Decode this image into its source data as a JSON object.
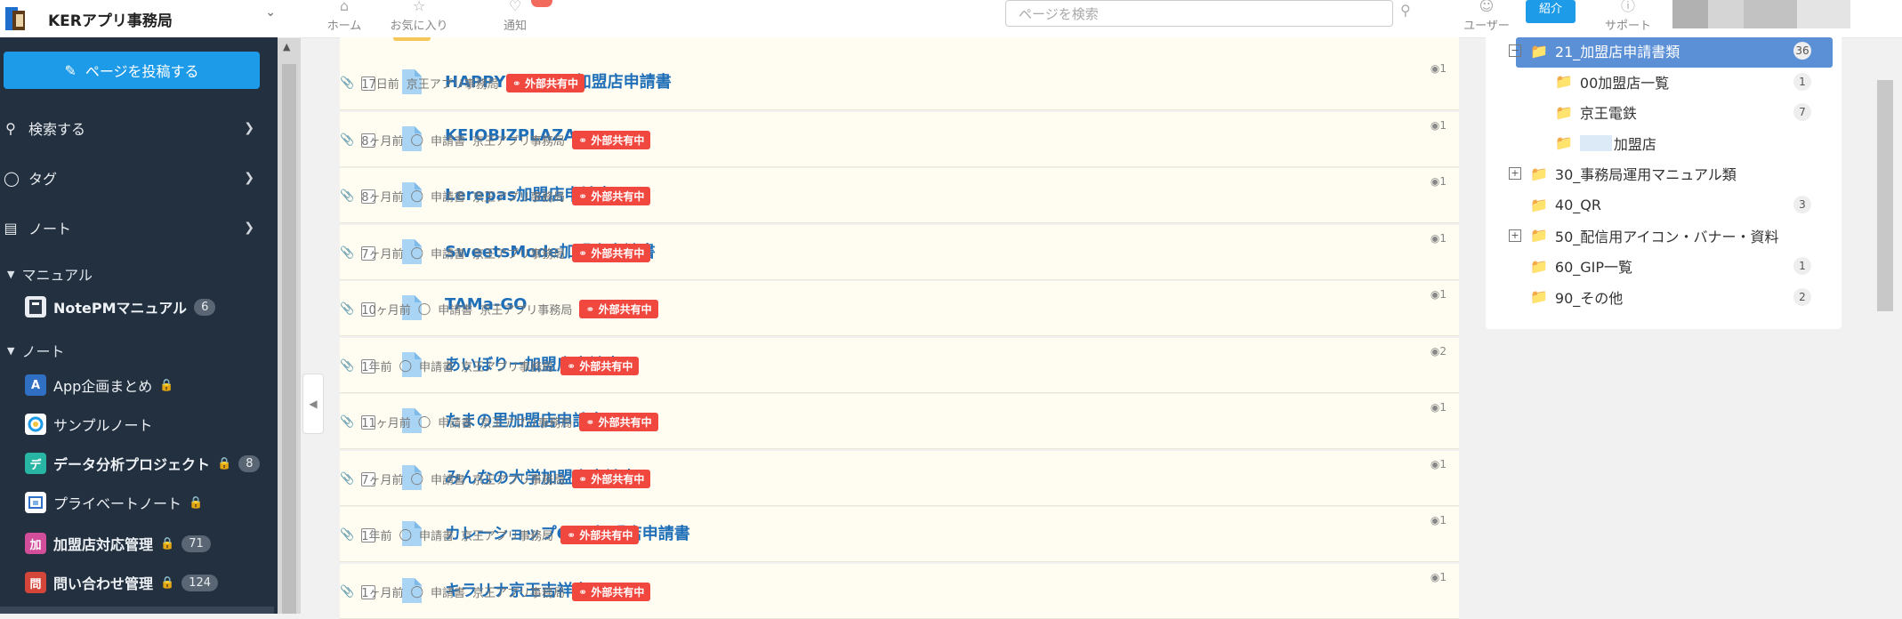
{
  "workspace": {
    "name": "KERアプリ事務局"
  },
  "sidebar": {
    "post_button": "ページを投稿する",
    "menu": [
      {
        "label": "検索する",
        "icon": "search-icon"
      },
      {
        "label": "タグ",
        "icon": "tag-icon"
      },
      {
        "label": "ノート",
        "icon": "notebook-icon"
      }
    ],
    "sections": {
      "manual": "マニュアル",
      "notes": "ノート"
    },
    "manual_items": [
      {
        "label": "NotePMマニュアル",
        "count": "6",
        "icon_color": "#ffffff"
      }
    ],
    "notes": [
      {
        "label": "App企画まとめ",
        "initial": "A",
        "color": "#2f6fc4",
        "locked": true,
        "count": ""
      },
      {
        "label": "サンプルノート",
        "initial": "",
        "color": "#ffffff",
        "locked": false,
        "count": ""
      },
      {
        "label": "データ分析プロジェクト",
        "initial": "デ",
        "color": "#29b5a3",
        "locked": true,
        "count": "8"
      },
      {
        "label": "プライベートノート",
        "initial": "",
        "color": "#ffffff",
        "locked": true,
        "count": ""
      },
      {
        "label": "加盟店対応管理",
        "initial": "加",
        "color": "#d24e9a",
        "locked": true,
        "count": "71"
      },
      {
        "label": "問い合わせ管理",
        "initial": "問",
        "color": "#d5463a",
        "locked": true,
        "count": "124"
      }
    ]
  },
  "topbar": {
    "nav": [
      {
        "label": "ホーム",
        "icon": "home-icon"
      },
      {
        "label": "お気に入り",
        "icon": "star-icon"
      },
      {
        "label": "通知",
        "icon": "bell-icon"
      }
    ],
    "search_placeholder": "ページを検索",
    "user_label": "ユーザー",
    "invite_label": "紹介",
    "support_label": "サポート"
  },
  "pages": [
    {
      "title": "HAPPYLEMON 加盟店申請書",
      "time": "17日前",
      "tag": "",
      "owner": "京王アプリ事務局",
      "share": "外部共有中",
      "views": "1"
    },
    {
      "title": "KEIOBIZPLAZA",
      "time": "8ヶ月前",
      "tag": "申請書",
      "owner": "京王アプリ事務局",
      "share": "外部共有中",
      "views": "1"
    },
    {
      "title": "Lerepas加盟店申請書",
      "time": "8ヶ月前",
      "tag": "申請書",
      "owner": "京王アプリ事務局",
      "share": "外部共有中",
      "views": "1"
    },
    {
      "title": "SweetsMode加盟店申請書",
      "time": "7ヶ月前",
      "tag": "申請書",
      "owner": "京王アプリ事務局",
      "share": "外部共有中",
      "views": "1"
    },
    {
      "title": "TAMa-GO",
      "time": "10ヶ月前",
      "tag": "申請書",
      "owner": "京王アプリ事務局",
      "share": "外部共有中",
      "views": "1"
    },
    {
      "title": "あいぼりー加盟店申請書",
      "time": "1年前",
      "tag": "申請書",
      "owner": "京王アプリ事務局",
      "share": "外部共有中",
      "views": "2"
    },
    {
      "title": "たまの里加盟店申請書",
      "time": "11ヶ月前",
      "tag": "申請書",
      "owner": "京王アプリ事務局",
      "share": "外部共有中",
      "views": "1"
    },
    {
      "title": "みんなの大学加盟店申請書",
      "time": "7ヶ月前",
      "tag": "申請書",
      "owner": "京王アプリ事務局",
      "share": "外部共有中",
      "views": "1"
    },
    {
      "title": "カレーショップC&C加盟店申請書",
      "time": "1年前",
      "tag": "申請書",
      "owner": "京王アプリ事務局",
      "share": "外部共有中",
      "views": "1"
    },
    {
      "title": "キラリナ京王吉祥寺",
      "time": "1ヶ月前",
      "tag": "申請書",
      "owner": "京王アプリ事務局",
      "share": "外部共有中",
      "views": "1"
    }
  ],
  "folders": [
    {
      "label": "21_加盟店申請書類",
      "count": "36",
      "toggle": "−",
      "selected": true
    },
    {
      "label": "00加盟店一覧",
      "count": "1",
      "toggle": "",
      "selected": false
    },
    {
      "label": "京王電鉄",
      "count": "7",
      "toggle": "",
      "selected": false
    },
    {
      "label": "加盟店",
      "count": "",
      "toggle": "",
      "selected": false
    },
    {
      "label": "30_事務局運用マニュアル類",
      "count": "",
      "toggle": "+",
      "selected": false
    },
    {
      "label": "40_QR",
      "count": "3",
      "toggle": "",
      "selected": false
    },
    {
      "label": "50_配信用アイコン・バナー・資料",
      "count": "",
      "toggle": "+",
      "selected": false
    },
    {
      "label": "60_GIP一覧",
      "count": "1",
      "toggle": "",
      "selected": false
    },
    {
      "label": "90_その他",
      "count": "2",
      "toggle": "",
      "selected": false
    }
  ]
}
